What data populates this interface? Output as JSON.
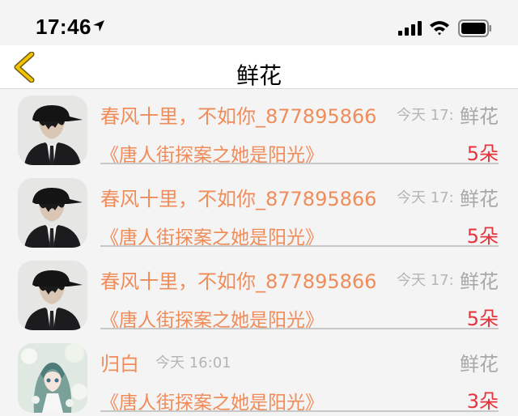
{
  "status": {
    "time": "17:46"
  },
  "nav": {
    "title": "鲜花"
  },
  "rows": [
    {
      "name": "春风十里，不如你_877895866",
      "time": "今天 17:",
      "gift": "鲜花",
      "book": "《唐人街探案之她是阳光》",
      "count": "5朵",
      "avatar": "man-in-cap"
    },
    {
      "name": "春风十里，不如你_877895866",
      "time": "今天 17:",
      "gift": "鲜花",
      "book": "《唐人街探案之她是阳光》",
      "count": "5朵",
      "avatar": "man-in-cap"
    },
    {
      "name": "春风十里，不如你_877895866",
      "time": "今天 17:",
      "gift": "鲜花",
      "book": "《唐人街探案之她是阳光》",
      "count": "5朵",
      "avatar": "man-in-cap"
    },
    {
      "name": "归白",
      "time": "今天 16:01",
      "gift": "鲜花",
      "book": "《唐人街探案之她是阳光》",
      "count": "3朵",
      "avatar": "anime-girl"
    }
  ],
  "colors": {
    "accent": "#f08c5a",
    "count": "#e8333c",
    "back": "#f2c400"
  }
}
